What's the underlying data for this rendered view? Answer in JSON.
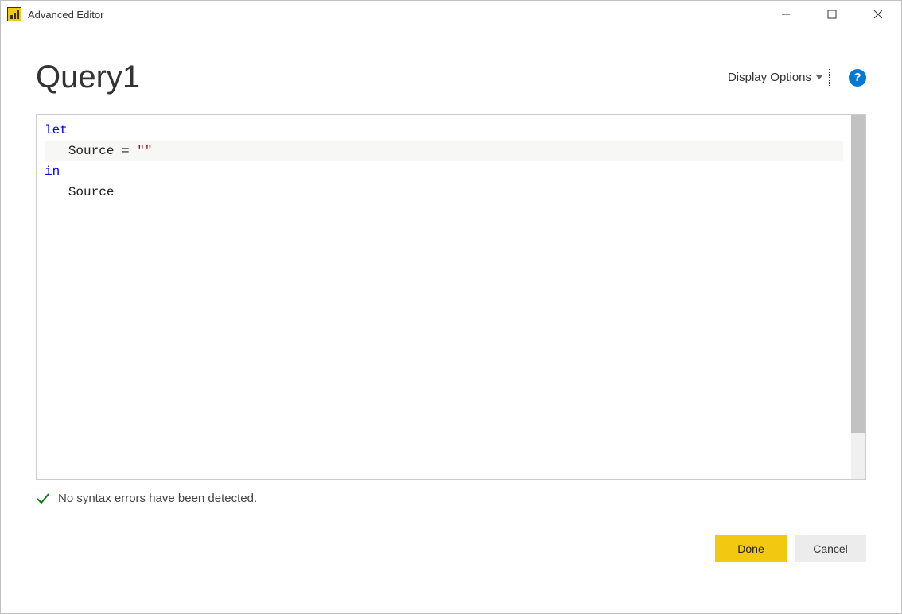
{
  "window": {
    "title": "Advanced Editor"
  },
  "header": {
    "query_name": "Query1",
    "display_options_label": "Display Options",
    "help_icon_glyph": "?"
  },
  "editor": {
    "lines": [
      {
        "tokens": [
          {
            "text": "let",
            "cls": "kw-blue"
          }
        ],
        "highlight": false,
        "indent": 0
      },
      {
        "tokens": [
          {
            "text": "Source = ",
            "cls": "kw-plain"
          },
          {
            "text": "\"\"",
            "cls": "kw-str"
          }
        ],
        "highlight": true,
        "indent": 1
      },
      {
        "tokens": [
          {
            "text": "in",
            "cls": "kw-blue"
          }
        ],
        "highlight": false,
        "indent": 0
      },
      {
        "tokens": [
          {
            "text": "Source",
            "cls": "kw-plain"
          }
        ],
        "highlight": false,
        "indent": 1
      }
    ]
  },
  "status": {
    "message": "No syntax errors have been detected."
  },
  "buttons": {
    "done": "Done",
    "cancel": "Cancel"
  }
}
